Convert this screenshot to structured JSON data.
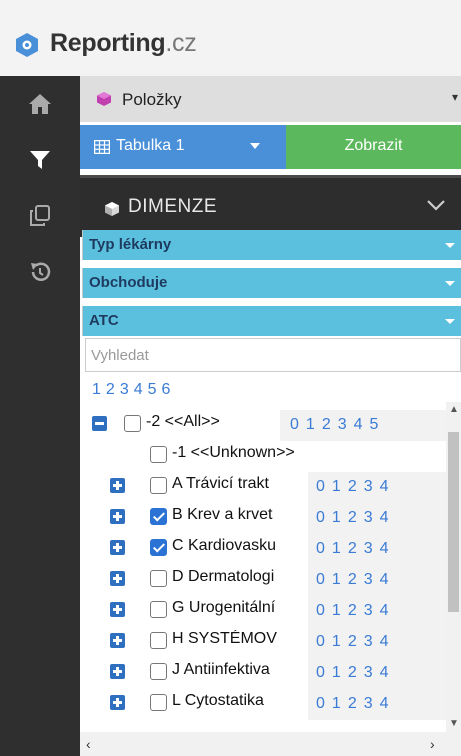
{
  "header": {
    "brand_main": "Reporting",
    "brand_suffix": ".cz"
  },
  "sidenav": {
    "icons": [
      "home-icon",
      "filter-icon",
      "copy-icon",
      "history-icon"
    ]
  },
  "items_bar": {
    "label": "Položky"
  },
  "table_button": {
    "label": "Tabulka 1"
  },
  "show_button": {
    "label": "Zobrazit"
  },
  "dimensions": {
    "label": "DIMENZE"
  },
  "filters": [
    {
      "label": "Typ lékárny"
    },
    {
      "label": "Obchoduje"
    },
    {
      "label": "ATC"
    }
  ],
  "search": {
    "placeholder": "Vyhledat"
  },
  "levels": [
    "1",
    "2",
    "3",
    "4",
    "5",
    "6"
  ],
  "tree": [
    {
      "label": "-2 <<All>>",
      "checked": false,
      "expander": "minus",
      "levels": [
        "0",
        "1",
        "2",
        "3",
        "4",
        "5"
      ]
    },
    {
      "label": "-1 <<Unknown>>",
      "checked": false,
      "expander": "none",
      "levels": []
    },
    {
      "label": "A Trávicí trakt",
      "checked": false,
      "expander": "plus",
      "levels": [
        "0",
        "1",
        "2",
        "3",
        "4"
      ]
    },
    {
      "label": "B Krev a krvet",
      "checked": true,
      "expander": "plus",
      "levels": [
        "0",
        "1",
        "2",
        "3",
        "4"
      ]
    },
    {
      "label": "C Kardiovasku",
      "checked": true,
      "expander": "plus",
      "levels": [
        "0",
        "1",
        "2",
        "3",
        "4"
      ]
    },
    {
      "label": "D Dermatologi",
      "checked": false,
      "expander": "plus",
      "levels": [
        "0",
        "1",
        "2",
        "3",
        "4"
      ]
    },
    {
      "label": "G Urogenitální",
      "checked": false,
      "expander": "plus",
      "levels": [
        "0",
        "1",
        "2",
        "3",
        "4"
      ]
    },
    {
      "label": "H SYSTÉMOV",
      "checked": false,
      "expander": "plus",
      "levels": [
        "0",
        "1",
        "2",
        "3",
        "4"
      ]
    },
    {
      "label": "J Antiinfektiva",
      "checked": false,
      "expander": "plus",
      "levels": [
        "0",
        "1",
        "2",
        "3",
        "4"
      ]
    },
    {
      "label": "L Cytostatika",
      "checked": false,
      "expander": "plus",
      "levels": [
        "0",
        "1",
        "2",
        "3",
        "4"
      ]
    }
  ],
  "colors": {
    "accent_blue": "#4a90d9",
    "show_green": "#5cb85c",
    "filter_cyan": "#5bc0de",
    "nav_dark": "#2f2f2f",
    "link_blue": "#3a7bd5"
  }
}
